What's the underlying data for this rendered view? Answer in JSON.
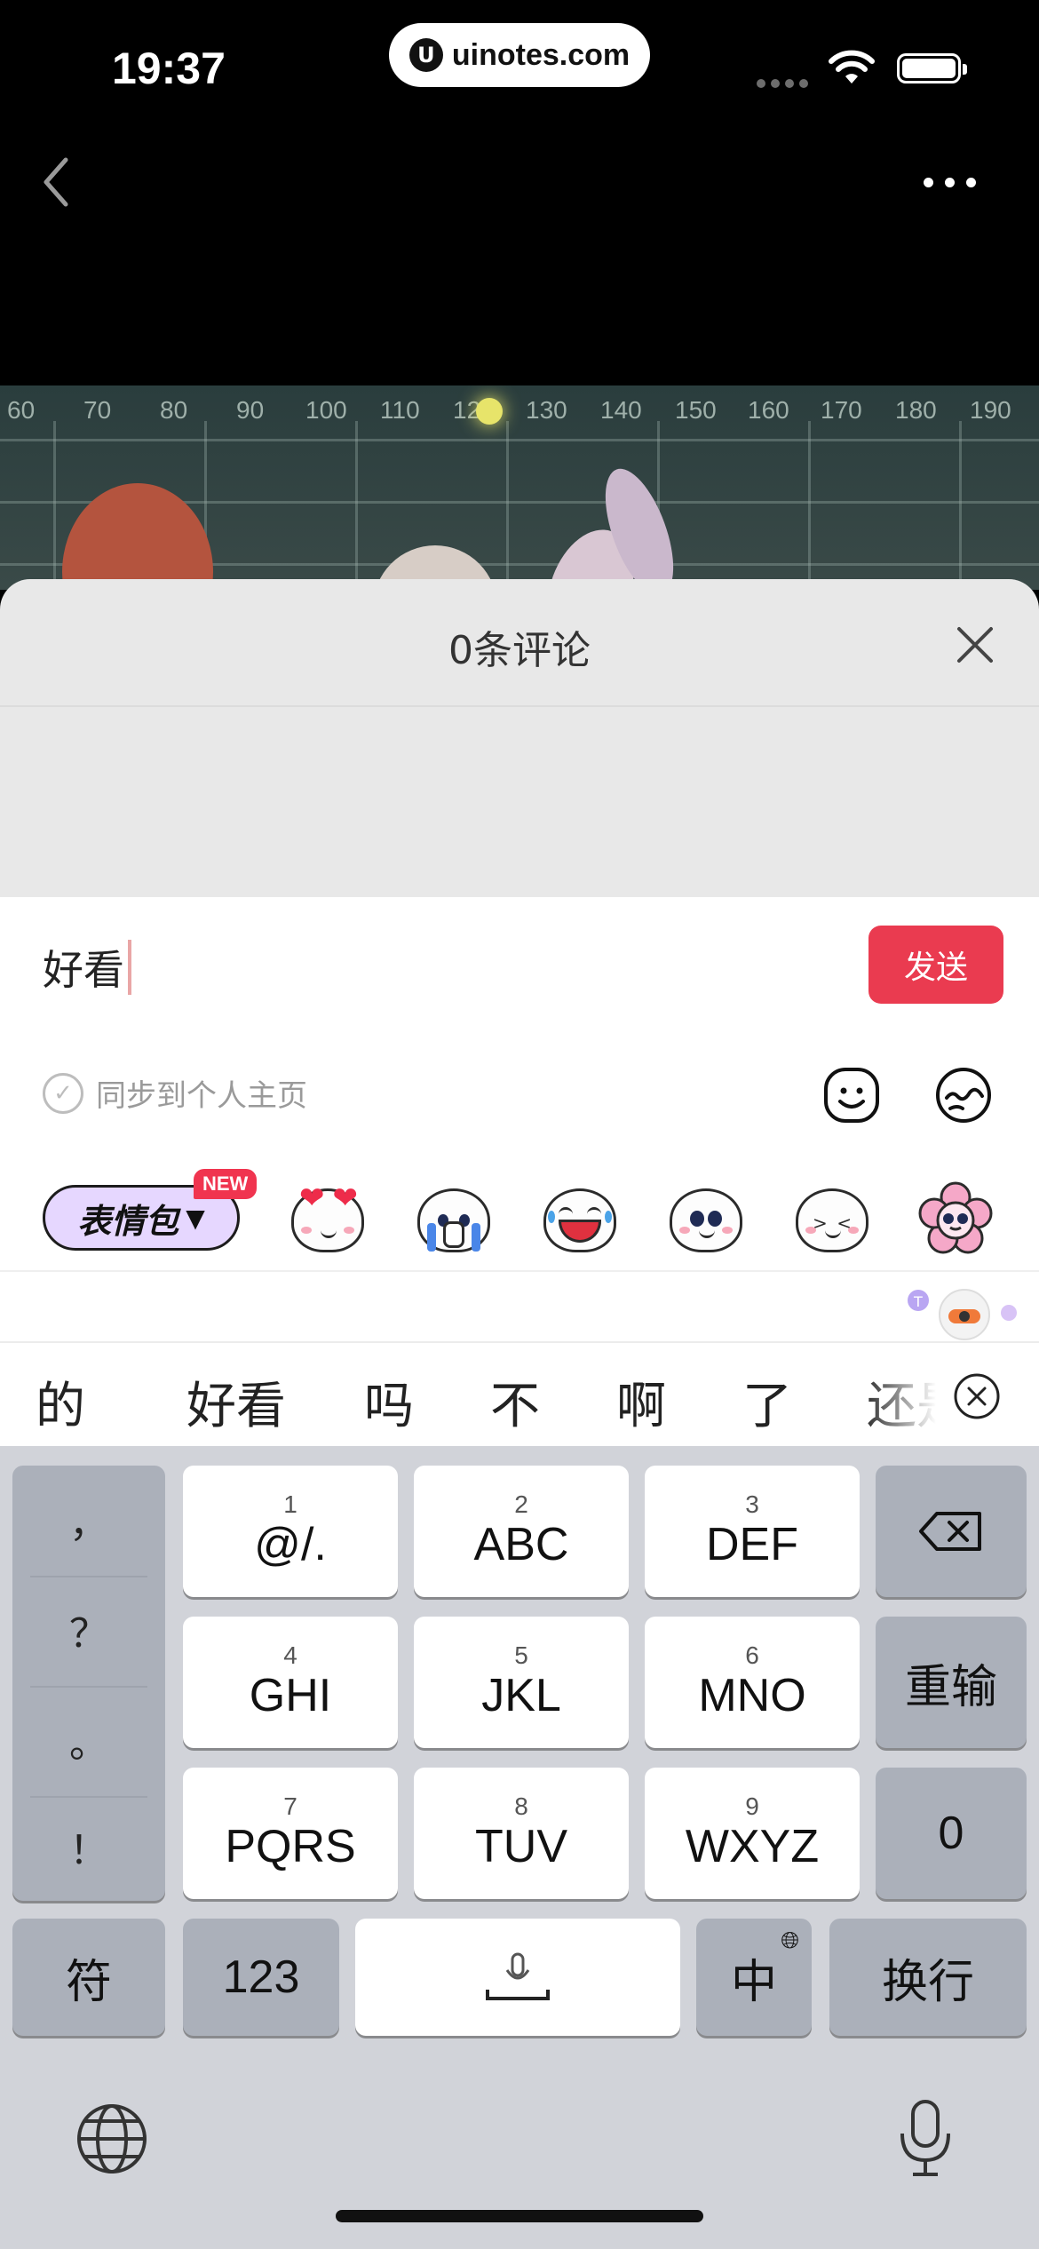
{
  "status_bar": {
    "time": "19:37",
    "url": "uinotes.com"
  },
  "video": {
    "ruler_ticks": [
      "60",
      "70",
      "80",
      "90",
      "100",
      "110",
      "120",
      "130",
      "140",
      "150",
      "160",
      "170",
      "180",
      "190"
    ]
  },
  "sheet": {
    "title": "0条评论"
  },
  "comment": {
    "value": "好看",
    "send_label": "发送",
    "sync_label": "同步到个人主页"
  },
  "stickers": {
    "pack_label": "表情包",
    "new_badge": "NEW"
  },
  "candidates": [
    "的",
    "好看",
    "吗",
    "不",
    "啊",
    "了",
    "还是"
  ],
  "keyboard": {
    "punctuation": [
      "，",
      "？",
      "。",
      "！"
    ],
    "keys": [
      {
        "num": "1",
        "label": "@/."
      },
      {
        "num": "2",
        "label": "ABC"
      },
      {
        "num": "3",
        "label": "DEF"
      },
      {
        "num": "4",
        "label": "GHI"
      },
      {
        "num": "5",
        "label": "JKL"
      },
      {
        "num": "6",
        "label": "MNO"
      },
      {
        "num": "7",
        "label": "PQRS"
      },
      {
        "num": "8",
        "label": "TUV"
      },
      {
        "num": "9",
        "label": "WXYZ"
      }
    ],
    "reenter": "重输",
    "zero": "0",
    "symbols": "符",
    "numbers": "123",
    "lang": "中",
    "newline": "换行"
  },
  "icons": [
    "back-icon",
    "more-icon",
    "close-icon",
    "emoji-icon",
    "sticker-face-icon",
    "backspace-icon",
    "mic-icon",
    "globe-icon"
  ]
}
